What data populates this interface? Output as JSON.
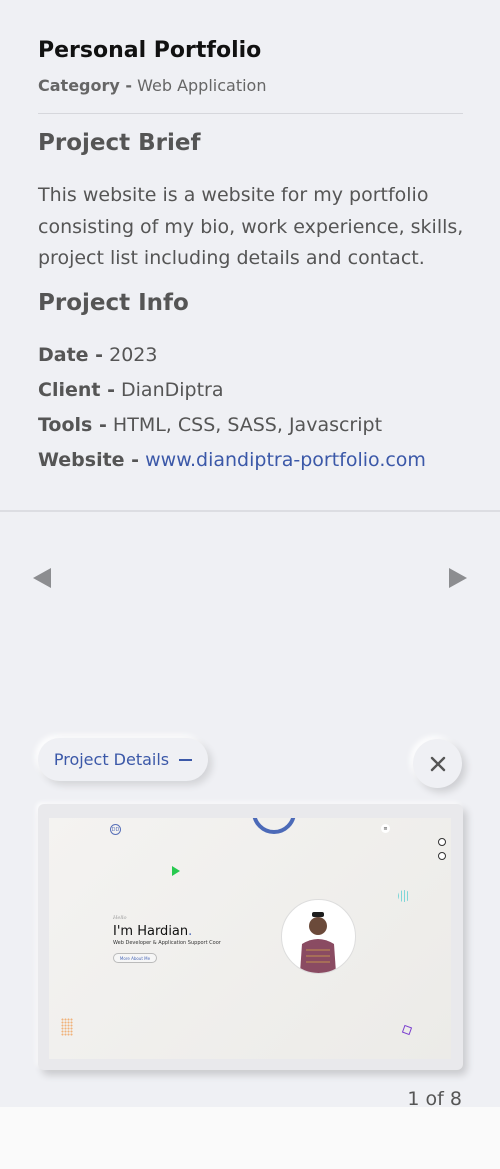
{
  "project": {
    "title": "Personal Portfolio",
    "category_label": "Category -",
    "category_value": "Web Application"
  },
  "brief": {
    "heading": "Project Brief",
    "text": "This website is a website for my portfolio consisting of my bio, work experience, skills, project list including details and contact."
  },
  "info": {
    "heading": "Project Info",
    "date_label": "Date -",
    "date_value": "2023",
    "client_label": "Client -",
    "client_value": "DianDiptra",
    "tools_label": "Tools -",
    "tools_value": "HTML, CSS, SASS, Javascript",
    "website_label": "Website -",
    "website_value": "www.diandiptra-portfolio.com"
  },
  "controls": {
    "details_toggle_label": "Project Details",
    "prev_icon": "triangle-left-icon",
    "next_icon": "triangle-right-icon",
    "close_icon": "close-icon"
  },
  "preview": {
    "logo_text": "DD",
    "hello": "Hello",
    "name": "I'm Hardian",
    "name_dot": ".",
    "subtitle": "Web Developer & Application Support Coor",
    "button": "More About Me"
  },
  "pagination": {
    "text": "1 of 8"
  },
  "colors": {
    "background": "#eff0f4",
    "accent": "#3b58a8",
    "title": "#111111",
    "text": "#555555"
  }
}
